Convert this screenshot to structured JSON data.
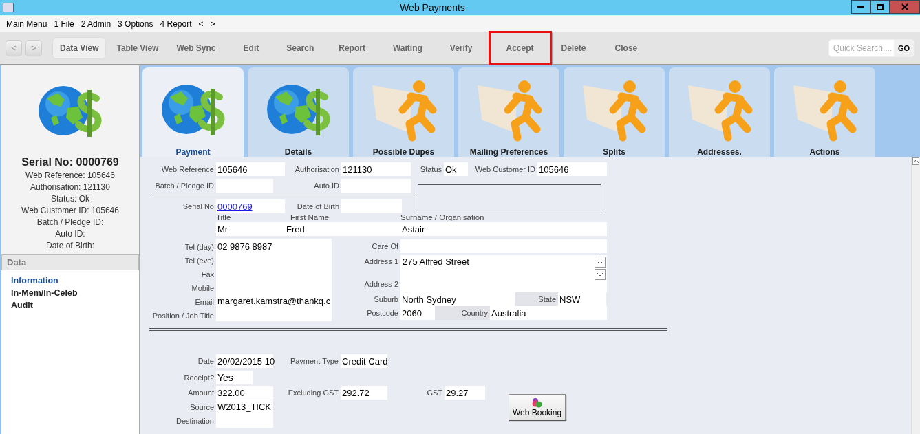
{
  "window": {
    "title": "Web Payments"
  },
  "menu": [
    "Main Menu",
    "1 File",
    "2 Admin",
    "3 Options",
    "4 Report",
    "<",
    ">"
  ],
  "toolbar": {
    "nav": [
      "<",
      ">"
    ],
    "actions": [
      {
        "label": "Data View",
        "selected": true,
        "highlighted": false
      },
      {
        "label": "Table View",
        "selected": false,
        "highlighted": false
      },
      {
        "label": "Web Sync",
        "selected": false,
        "highlighted": false
      },
      {
        "label": "Edit",
        "selected": false,
        "highlighted": false
      },
      {
        "label": "Search",
        "selected": false,
        "highlighted": false
      },
      {
        "label": "Report",
        "selected": false,
        "highlighted": false
      },
      {
        "label": "Waiting",
        "selected": false,
        "highlighted": false
      },
      {
        "label": "Verify",
        "selected": false,
        "highlighted": false
      },
      {
        "label": "Accept",
        "selected": false,
        "highlighted": true
      },
      {
        "label": "Delete",
        "selected": false,
        "highlighted": false
      },
      {
        "label": "Close",
        "selected": false,
        "highlighted": false
      }
    ],
    "search": {
      "placeholder": "Quick Search....",
      "button": "GO"
    }
  },
  "sidebar": {
    "heading": "Serial No: 0000769",
    "lines": [
      "Web Reference: 105646",
      "Authorisation: 121130",
      "Status: Ok",
      "Web Customer ID: 105646",
      "Batch / Pledge ID:",
      "Auto ID:",
      "Date of Birth:"
    ],
    "section": "Data",
    "items": [
      {
        "label": "Information",
        "selected": true
      },
      {
        "label": "In-Mem/In-Celeb",
        "selected": false
      },
      {
        "label": "Audit",
        "selected": false
      }
    ]
  },
  "tabs": [
    {
      "label": "Payment",
      "kind": "globe",
      "selected": true
    },
    {
      "label": "Details",
      "kind": "globe",
      "selected": false
    },
    {
      "label": "Possible Dupes",
      "kind": "runner",
      "selected": false
    },
    {
      "label": "Mailing Preferences",
      "kind": "runner",
      "selected": false
    },
    {
      "label": "Splits",
      "kind": "runner",
      "selected": false
    },
    {
      "label": "Addresses.",
      "kind": "runner",
      "selected": false
    },
    {
      "label": "Actions",
      "kind": "runner",
      "selected": false
    }
  ],
  "form": {
    "web_reference": {
      "label": "Web Reference",
      "value": "105646"
    },
    "authorisation": {
      "label": "Authorisation",
      "value": "121130"
    },
    "status": {
      "label": "Status",
      "value": "Ok"
    },
    "web_customer_id": {
      "label": "Web Customer ID",
      "value": "105646"
    },
    "batch_pledge_id": {
      "label": "Batch / Pledge ID"
    },
    "auto_id": {
      "label": "Auto ID"
    },
    "serial_no": {
      "label": "Serial No",
      "value": "0000769"
    },
    "date_of_birth": {
      "label": "Date of Birth"
    },
    "title": {
      "label": "Title",
      "value": "Mr"
    },
    "first_name": {
      "label": "First Name",
      "value": "Fred"
    },
    "surname": {
      "label": "Surname / Organisation",
      "value": "Astair"
    },
    "tel_day": {
      "label": "Tel (day)",
      "value": "02 9876 8987"
    },
    "tel_eve": {
      "label": "Tel (eve)"
    },
    "fax": {
      "label": "Fax"
    },
    "mobile": {
      "label": "Mobile"
    },
    "email": {
      "label": "Email",
      "value": "margaret.kamstra@thankq.c"
    },
    "position": {
      "label": "Position / Job Title"
    },
    "care_of": {
      "label": "Care Of"
    },
    "address_1": {
      "label": "Address 1",
      "value": "275 Alfred Street"
    },
    "address_2": {
      "label": "Address 2"
    },
    "suburb": {
      "label": "Suburb",
      "value": "North Sydney"
    },
    "state": {
      "label": "State",
      "value": "NSW"
    },
    "postcode": {
      "label": "Postcode",
      "value": "2060"
    },
    "country": {
      "label": "Country",
      "value": "Australia"
    },
    "date": {
      "label": "Date",
      "value": "20/02/2015 10"
    },
    "payment_type": {
      "label": "Payment Type",
      "value": "Credit Card"
    },
    "receipt": {
      "label": "Receipt?",
      "value": "Yes"
    },
    "amount": {
      "label": "Amount",
      "value": "322.00"
    },
    "excluding_gst": {
      "label": "Excluding GST",
      "value": "292.72"
    },
    "gst": {
      "label": "GST",
      "value": "29.27"
    },
    "source": {
      "label": "Source",
      "value": "W2013_TICK"
    },
    "destination": {
      "label": "Destination"
    },
    "web_booking_button": "Web Booking"
  }
}
